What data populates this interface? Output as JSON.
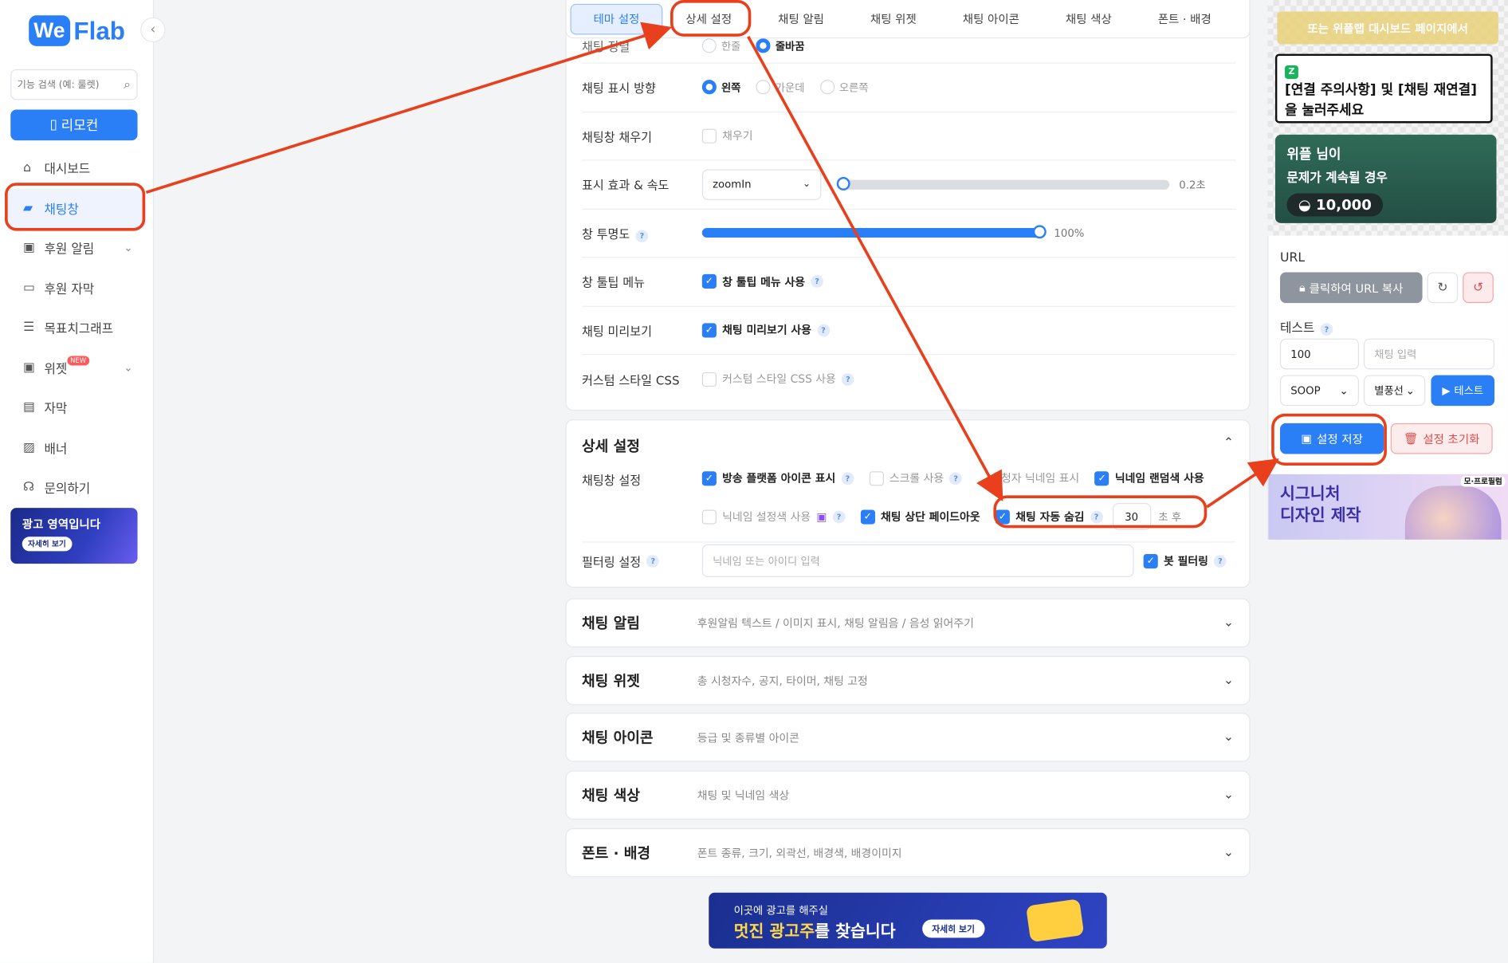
{
  "brand": {
    "we": "We",
    "flab": "Flab"
  },
  "sidebar": {
    "search_placeholder": "기능 검색 (예: 룰렛)",
    "remote_label": "리모컨",
    "items": [
      {
        "label": "대시보드",
        "icon": "home-icon"
      },
      {
        "label": "채팅창",
        "icon": "chat-icon",
        "active": true
      },
      {
        "label": "후원 알림",
        "icon": "gift-icon",
        "expandable": true
      },
      {
        "label": "후원 자막",
        "icon": "caption-icon"
      },
      {
        "label": "목표치그래프",
        "icon": "bars-icon"
      },
      {
        "label": "위젯",
        "icon": "gift-icon",
        "badge": "NEW",
        "expandable": true
      },
      {
        "label": "자막",
        "icon": "images-icon"
      },
      {
        "label": "배너",
        "icon": "image-icon"
      },
      {
        "label": "문의하기",
        "icon": "headset-icon"
      }
    ],
    "ad": {
      "title": "광고 영역입니다",
      "button": "자세히 보기"
    }
  },
  "tabs": [
    "테마 설정",
    "상세 설정",
    "채팅 알림",
    "채팅 위젯",
    "채팅 아이콘",
    "채팅 색상",
    "폰트 · 배경"
  ],
  "settings": {
    "partial_label": "채팅 정렬",
    "partial_options": [
      "한줄",
      "줄바꿈"
    ],
    "direction": {
      "label": "채팅 표시 방향",
      "options": [
        "왼쪽",
        "가운데",
        "오른쪽"
      ],
      "selected": "왼쪽"
    },
    "fill": {
      "label": "채팅창 채우기",
      "check": "채우기"
    },
    "effect": {
      "label": "표시 효과 & 속도",
      "value": "zoomIn",
      "speed": 0.2,
      "speed_text": "0.2초",
      "slider_fraction": 0.0
    },
    "opacity": {
      "label": "창 투명도",
      "value": 100,
      "value_text": "100%"
    },
    "tooltip": {
      "label": "창 툴팁 메뉴",
      "check": "창 툴팁 메뉴 사용"
    },
    "preview": {
      "label": "채팅 미리보기",
      "check": "채팅 미리보기 사용"
    },
    "css": {
      "label": "커스텀 스타일 CSS",
      "check": "커스텀 스타일 CSS 사용"
    }
  },
  "detail": {
    "title": "상세 설정",
    "chat_label": "채팅창 설정",
    "options": [
      {
        "label": "방송 플랫폼 아이콘 표시",
        "on": true
      },
      {
        "label": "스크롤 사용",
        "on": false
      },
      {
        "label": "시청자 닉네임 표시",
        "on": false
      },
      {
        "label": "닉네임 랜덤색 사용",
        "on": true
      },
      {
        "label": "닉네임 설정색 사용",
        "on": false
      },
      {
        "label": "채팅 상단 페이드아웃",
        "on": true
      },
      {
        "label": "채팅 자동 숨김",
        "on": true
      }
    ],
    "autohide_seconds": "30",
    "autohide_unit": "초 후",
    "filter_label": "필터링 설정",
    "filter_placeholder": "닉네임 또는 아이디 입력",
    "bot_filter": "봇 필터링"
  },
  "sections": [
    {
      "title": "채팅 알림",
      "desc": "후원알림 텍스트 / 이미지 표시, 채팅 알림음 / 음성 읽어주기"
    },
    {
      "title": "채팅 위젯",
      "desc": "총 시청자수, 공지, 타이머, 채팅 고정"
    },
    {
      "title": "채팅 아이콘",
      "desc": "등급 및 종류별 아이콘"
    },
    {
      "title": "채팅 색상",
      "desc": "채팅 및 닉네임 색상"
    },
    {
      "title": "폰트 · 배경",
      "desc": "폰트 종류, 크기, 외곽선, 배경색, 배경이미지"
    }
  ],
  "bottom_ad": {
    "small": "이곳에 광고를 해주실",
    "big_a": "멋진 광고주",
    "big_b": "를 찾습니다",
    "button": "자세히 보기"
  },
  "preview_panel": {
    "top_text": "또는 위플랩 대시보드 페이지에서",
    "platform_icon": "Z",
    "message": "[연결 주의사항] 및 [채팅 재연결]을 눌러주세요",
    "donation_name": "위플 님이",
    "donation_text": "문제가 계속될 경우",
    "donation_amount": "10,000"
  },
  "right": {
    "url_label": "URL",
    "copy_label": "클릭하여 URL 복사",
    "test_label": "테스트",
    "amount": "100",
    "chat_placeholder": "채팅 입력",
    "platform": "SOOP",
    "nickname": "별풍선",
    "test_button": "테스트",
    "save": "설정 저장",
    "reset": "설정 초기화",
    "ad_line1": "시그니처",
    "ad_line2": "디자인 제작",
    "ad_tag": "모·프로필럼"
  },
  "colors": {
    "accent": "#2b7ff6",
    "annotation": "#e8401c"
  }
}
